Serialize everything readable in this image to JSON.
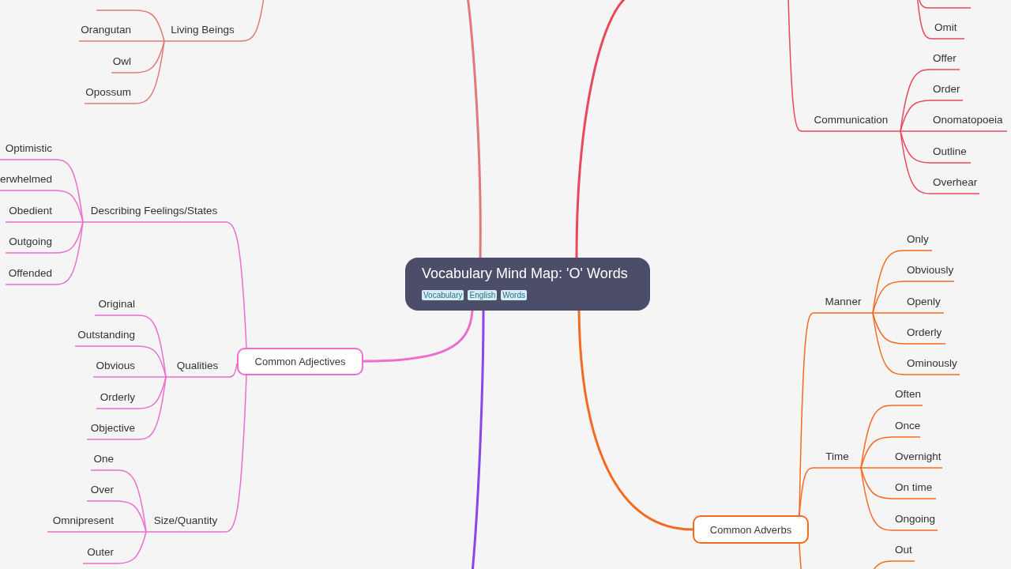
{
  "central": {
    "title": "Vocabulary Mind Map: 'O' Words",
    "tags": [
      "Vocabulary",
      "English",
      "Words"
    ]
  },
  "branches": [
    {
      "color": "#e3787a",
      "children": [
        {
          "label": "Living Beings",
          "children": [
            {
              "kind": "cut"
            },
            {
              "label": "Orangutan"
            },
            {
              "label": "Owl"
            },
            {
              "label": "Opossum"
            }
          ]
        }
      ]
    },
    {
      "color": "#e8495c",
      "children": [
        {
          "children": [
            {
              "kind": "cut"
            },
            {
              "label": "Omit"
            }
          ]
        },
        {
          "label": "Communication",
          "children": [
            {
              "label": "Offer"
            },
            {
              "label": "Order"
            },
            {
              "label": "Onomatopoeia"
            },
            {
              "label": "Outline"
            },
            {
              "label": "Overhear"
            }
          ]
        }
      ]
    },
    {
      "label": "Common Adjectives",
      "color": "#ea6fcf",
      "children": [
        {
          "label": "Describing Feelings/States",
          "children": [
            {
              "label": "Optimistic"
            },
            {
              "label": "erwhelmed"
            },
            {
              "label": "Obedient"
            },
            {
              "label": "Outgoing"
            },
            {
              "label": "Offended"
            }
          ]
        },
        {
          "label": "Qualities",
          "children": [
            {
              "label": "Original"
            },
            {
              "label": "Outstanding"
            },
            {
              "label": "Obvious"
            },
            {
              "label": "Orderly"
            },
            {
              "label": "Objective"
            }
          ]
        },
        {
          "label": "Size/Quantity",
          "children": [
            {
              "label": "One"
            },
            {
              "label": "Over"
            },
            {
              "label": "Omnipresent"
            },
            {
              "label": "Outer"
            }
          ]
        }
      ]
    },
    {
      "label": "Common Adverbs",
      "color": "#f56a1f",
      "children": [
        {
          "label": "Manner",
          "children": [
            {
              "label": "Only"
            },
            {
              "label": "Obviously"
            },
            {
              "label": "Openly"
            },
            {
              "label": "Orderly"
            },
            {
              "label": "Ominously"
            }
          ]
        },
        {
          "label": "Time",
          "children": [
            {
              "label": "Often"
            },
            {
              "label": "Once"
            },
            {
              "label": "Overnight"
            },
            {
              "label": "On time"
            },
            {
              "label": "Ongoing"
            }
          ]
        },
        {
          "children": [
            {
              "label": "Out"
            }
          ]
        }
      ]
    },
    {
      "color": "#8b44e6"
    }
  ]
}
